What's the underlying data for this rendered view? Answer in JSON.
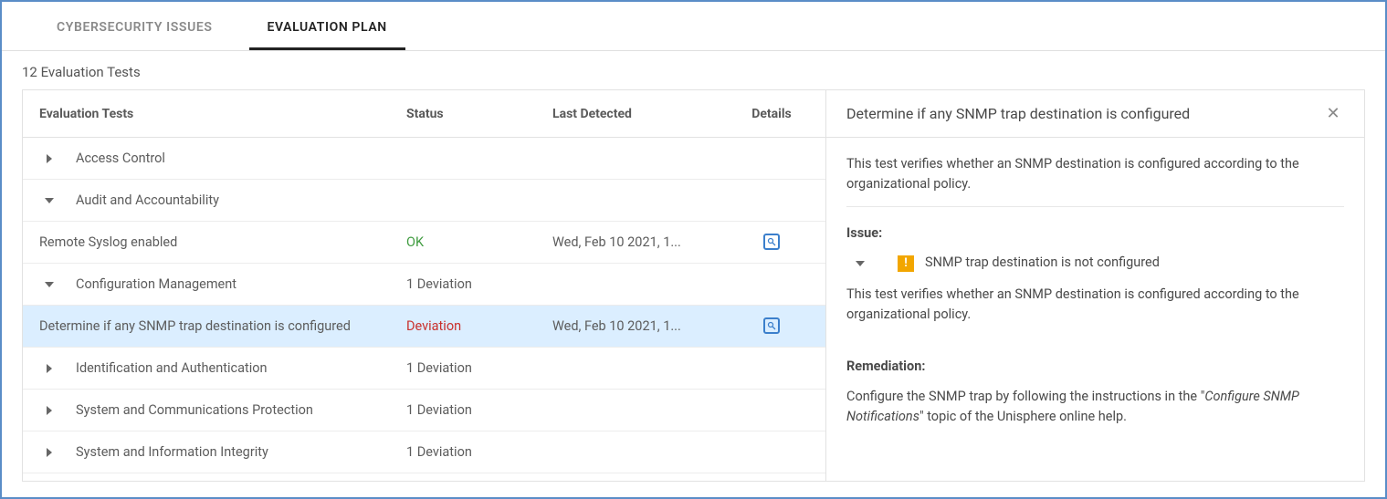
{
  "tabs": {
    "issues": "CYBERSECURITY ISSUES",
    "plan": "EVALUATION PLAN"
  },
  "subheader": "12 Evaluation Tests",
  "columns": {
    "name": "Evaluation Tests",
    "status": "Status",
    "last": "Last Detected",
    "details": "Details"
  },
  "rows": {
    "access_control": {
      "label": "Access Control"
    },
    "audit": {
      "label": "Audit and Accountability"
    },
    "remote_syslog": {
      "label": "Remote Syslog enabled",
      "status": "OK",
      "last": "Wed, Feb 10 2021, 1..."
    },
    "config_mgmt": {
      "label": "Configuration Management",
      "status": "1 Deviation"
    },
    "snmp_test": {
      "label": "Determine if any SNMP trap destination is configured",
      "status": "Deviation",
      "last": "Wed, Feb 10 2021, 1..."
    },
    "id_auth": {
      "label": "Identification and Authentication",
      "status": "1 Deviation"
    },
    "syscomm": {
      "label": "System and Communications Protection",
      "status": "1 Deviation"
    },
    "sysinfo": {
      "label": "System and Information Integrity",
      "status": "1 Deviation"
    }
  },
  "details": {
    "title": "Determine if any SNMP trap destination is configured",
    "description": "This test verifies whether an SNMP destination is configured according to the organizational policy.",
    "issue_label": "Issue:",
    "issue_title": "SNMP trap destination is not configured",
    "issue_desc": "This test verifies whether an SNMP destination is configured according to the organizational policy.",
    "remediation_label": "Remediation:",
    "remediation_prefix": "Configure the SNMP trap by following the instructions in the \"",
    "remediation_topic": "Configure SNMP Notifications",
    "remediation_suffix": "\" topic of the Unisphere online help."
  }
}
